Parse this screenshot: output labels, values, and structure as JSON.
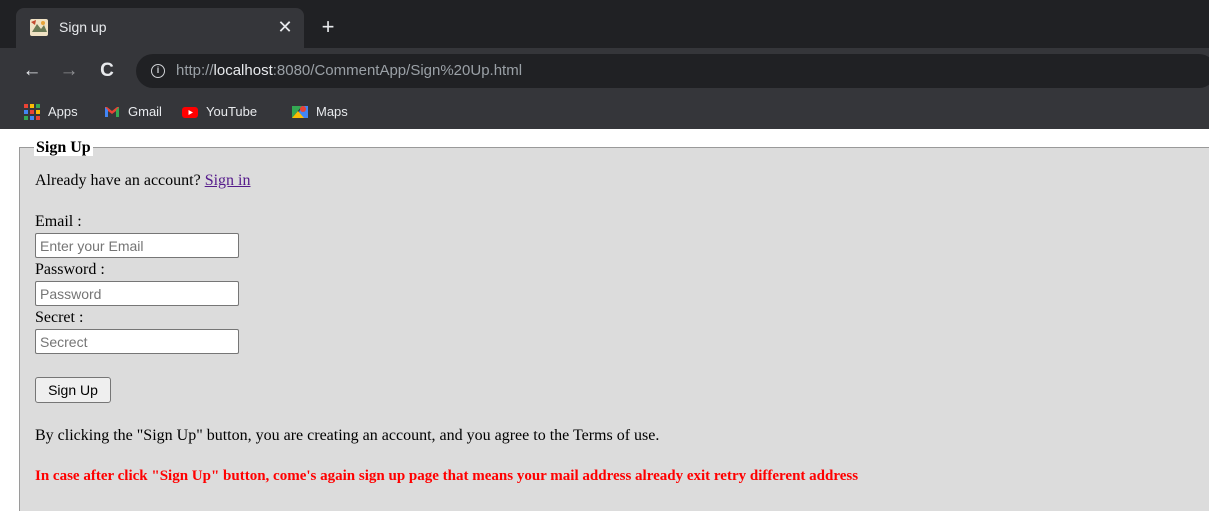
{
  "browser": {
    "tab_title": "Sign up",
    "new_tab_symbol": "+",
    "url_prefix": "http://",
    "url_host": "localhost",
    "url_rest": ":8080/CommentApp/Sign%20Up.html",
    "bookmarks": [
      {
        "label": "Apps",
        "icon": "apps-grid-icon"
      },
      {
        "label": "Gmail",
        "icon": "gmail-icon"
      },
      {
        "label": "YouTube",
        "icon": "youtube-icon"
      },
      {
        "label": "Maps",
        "icon": "maps-icon"
      }
    ],
    "colors": {
      "frame": "#202124",
      "toolbar": "#35363a",
      "text": "#e8eaed"
    }
  },
  "form": {
    "legend": "Sign Up",
    "already_text": "Already have an account?",
    "signin_link": "Sign in",
    "email_label": "Email :",
    "email_placeholder": "Enter your Email",
    "password_label": "Password :",
    "password_placeholder": "Password",
    "secret_label": "Secret :",
    "secret_placeholder": "Secrect",
    "submit_label": "Sign Up",
    "terms_text": "By clicking the \"Sign Up\" button, you are creating an account, and you agree to the Terms of use.",
    "warning_text": "In case after click \"Sign Up\" button, come's again sign up page that means your mail address already exit retry different address",
    "colors": {
      "panel": "#dcdcdc",
      "link": "#551a8b",
      "warning": "#ff0000"
    }
  }
}
